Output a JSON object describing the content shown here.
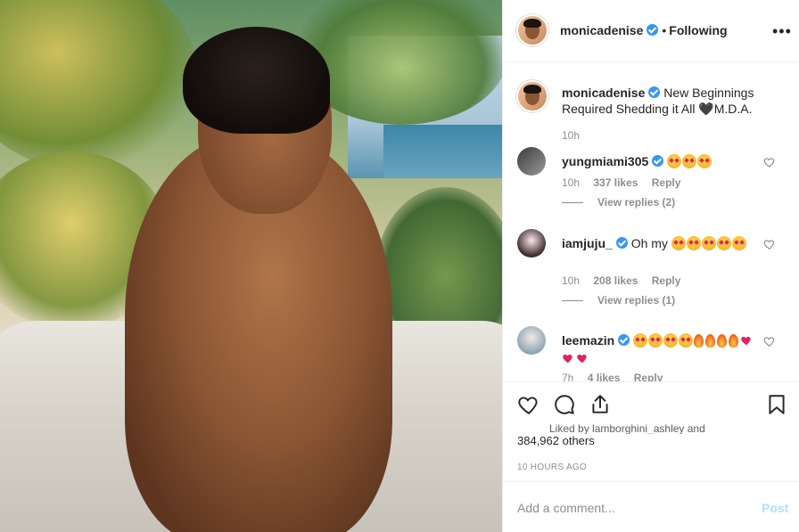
{
  "post": {
    "author": "monicadenise",
    "follow_separator": "•",
    "follow_status": "Following",
    "more_label": "•••"
  },
  "caption": {
    "username": "monicadenise",
    "text": "New Beginnings Required Shedding it All 🖤M.D.A.",
    "time": "10h"
  },
  "comments": [
    {
      "username": "yungmiami305",
      "text": "",
      "emoji": [
        "heart-eyes-emoji",
        "heart-eyes-emoji",
        "heart-eyes-emoji"
      ],
      "time": "10h",
      "likes": "337 likes",
      "reply_label": "Reply",
      "view_replies": "View replies (2)"
    },
    {
      "username": "iamjuju_",
      "text": "Oh my",
      "emoji": [
        "heart-eyes-emoji",
        "heart-eyes-emoji",
        "heart-eyes-emoji",
        "heart-eyes-emoji",
        "heart-eyes-emoji"
      ],
      "time": "10h",
      "likes": "208 likes",
      "reply_label": "Reply",
      "view_replies": "View replies (1)"
    },
    {
      "username": "leemazin",
      "text": "",
      "emoji": [
        "heart-eyes-emoji",
        "heart-eyes-emoji",
        "heart-eyes-emoji",
        "heart-eyes-emoji",
        "fire-emoji",
        "fire-emoji",
        "fire-emoji",
        "fire-emoji",
        "red-heart-emoji",
        "red-heart-emoji",
        "red-heart-emoji"
      ],
      "time": "7h",
      "likes": "4 likes",
      "reply_label": "Reply"
    }
  ],
  "actions": {
    "icons": [
      "heart-outline-icon",
      "comment-icon",
      "share-icon",
      "bookmark-icon"
    ]
  },
  "likes": {
    "liked_by": "Liked by lamborghini_ashley and",
    "others": "384,962 others"
  },
  "timestamp": "10 HOURS AGO",
  "add_comment": {
    "placeholder": "Add a comment...",
    "post_label": "Post"
  },
  "colors": {
    "verified": "#3897f0",
    "muted": "#8e8e8e",
    "post_disabled": "#b2dffc"
  }
}
